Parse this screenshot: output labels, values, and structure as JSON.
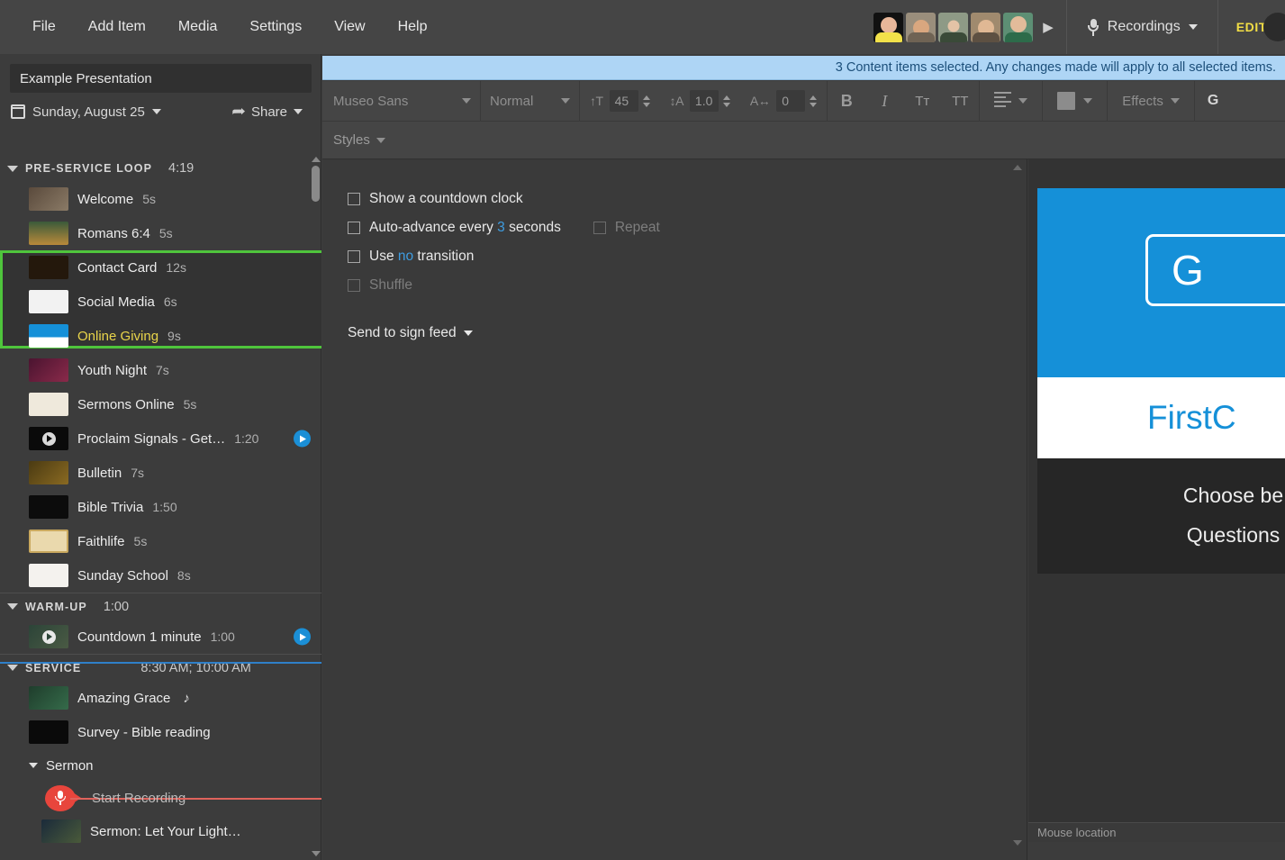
{
  "menu": {
    "items": [
      "File",
      "Add Item",
      "Media",
      "Settings",
      "View",
      "Help"
    ]
  },
  "topbar": {
    "avatars_next_icon": "play-triangle-icon",
    "recordings_label": "Recordings",
    "recordings_icon": "microphone-icon",
    "edit_label": "EDIT"
  },
  "sidebar": {
    "presentation_title": "Example Presentation",
    "date_label": "Sunday, August 25",
    "date_icon": "calendar-icon",
    "share_label": "Share",
    "share_icon": "share-arrow-icon",
    "groups": [
      {
        "name": "PRE-SERVICE LOOP",
        "time": "4:19",
        "items": [
          {
            "label": "Welcome",
            "time": "5s",
            "thumb": "welcome"
          },
          {
            "label": "Romans 6:4",
            "time": "5s",
            "thumb": "romans"
          },
          {
            "label": "Contact Card",
            "time": "12s",
            "thumb": "contact"
          },
          {
            "label": "Social Media",
            "time": "6s",
            "thumb": "social"
          },
          {
            "label": "Online Giving",
            "time": "9s",
            "thumb": "giving",
            "highlight": true
          },
          {
            "label": "Youth Night",
            "time": "7s",
            "thumb": "youth"
          },
          {
            "label": "Sermons Online",
            "time": "5s",
            "thumb": "sermons"
          },
          {
            "label": "Proclaim Signals - Get…",
            "time": "1:20",
            "thumb": "video",
            "play": true
          },
          {
            "label": "Bulletin",
            "time": "7s",
            "thumb": "bulletin"
          },
          {
            "label": "Bible Trivia",
            "time": "1:50",
            "thumb": "trivia"
          },
          {
            "label": "Faithlife",
            "time": "5s",
            "thumb": "faithlife"
          },
          {
            "label": "Sunday School",
            "time": "8s",
            "thumb": "school"
          }
        ]
      },
      {
        "name": "WARM-UP",
        "time": "1:00",
        "items": [
          {
            "label": "Countdown 1 minute",
            "time": "1:00",
            "thumb": "countdown",
            "play": true
          }
        ]
      },
      {
        "name": "SERVICE",
        "time": "8:30 AM; 10:00 AM",
        "items": [
          {
            "label": "Amazing Grace",
            "time": "",
            "thumb": "grace",
            "note": "♪"
          },
          {
            "label": "Survey - Bible reading",
            "time": "",
            "thumb": "survey"
          }
        ]
      }
    ],
    "sermon_group": "Sermon",
    "start_recording_label": "Start Recording",
    "start_recording_icon": "record-microphone-icon",
    "sermon_item": "Sermon: Let Your Light…"
  },
  "banner": {
    "message": "3 Content items selected. Any changes made will apply to all selected items."
  },
  "toolbar": {
    "font_family": "Museo Sans",
    "font_weight": "Normal",
    "font_size_icon": "font-size-icon",
    "font_size": "45",
    "line_height_icon": "line-height-icon",
    "line_height": "1.0",
    "tracking_icon": "letter-spacing-icon",
    "tracking": "0",
    "bold_label": "B",
    "italic_label": "I",
    "smallcaps_label": "Tᴛ",
    "allcaps_label": "TT",
    "align_icon": "align-left-icon",
    "color_swatch": "#8c8c8c",
    "effects_label": "Effects",
    "g_label": "G",
    "styles_label": "Styles"
  },
  "main": {
    "options": [
      {
        "text_before": "Show a countdown clock",
        "highlight": "",
        "text_after": "",
        "disabled": false
      },
      {
        "text_before": "Auto-advance every ",
        "highlight": "3",
        "text_after": " seconds",
        "disabled": false
      },
      {
        "text_before": "Use ",
        "highlight": "no",
        "text_after": " transition",
        "disabled": false
      },
      {
        "text_before": "Shuffle",
        "highlight": "",
        "text_after": "",
        "disabled": true
      }
    ],
    "repeat_label": "Repeat",
    "send_to_sign_feed": "Send to sign feed"
  },
  "preview": {
    "slide_button_text": "G",
    "slide_site": "FirstC",
    "slide_line1": "Choose be",
    "slide_line2": "Questions",
    "status_label": "Mouse location"
  }
}
